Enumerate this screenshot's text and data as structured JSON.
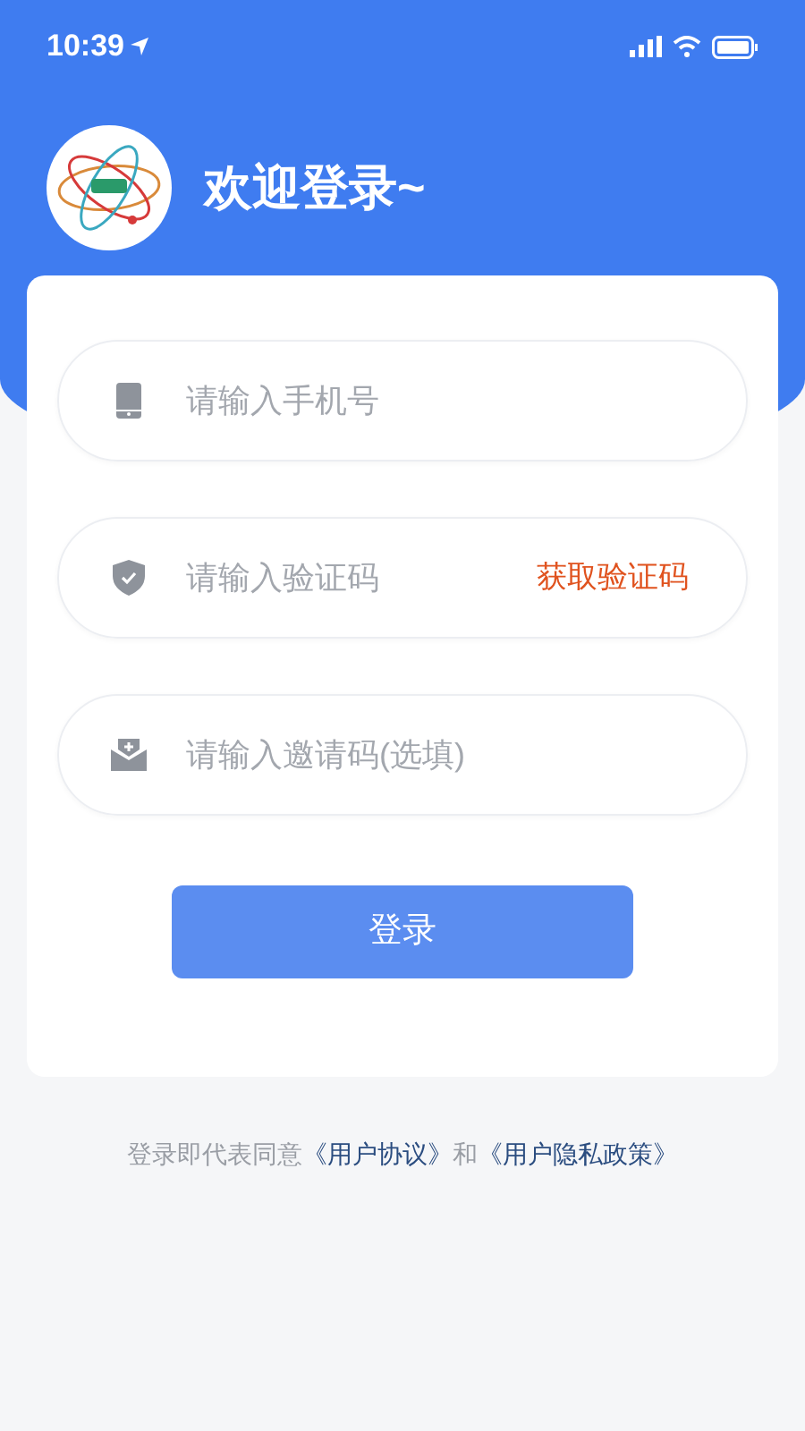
{
  "status_bar": {
    "time": "10:39"
  },
  "header": {
    "title": "欢迎登录~"
  },
  "fields": [
    {
      "placeholder": "请输入手机号"
    },
    {
      "placeholder": "请输入验证码",
      "action": "获取验证码"
    },
    {
      "placeholder": "请输入邀请码(选填)"
    }
  ],
  "login_button": "登录",
  "agreement": [
    {
      "kind": "text",
      "text": "登录即代表同意"
    },
    {
      "kind": "link",
      "text": "《用户协议》"
    },
    {
      "kind": "text",
      "text": "和"
    },
    {
      "kind": "link",
      "text": "《用户隐私政策》"
    }
  ]
}
